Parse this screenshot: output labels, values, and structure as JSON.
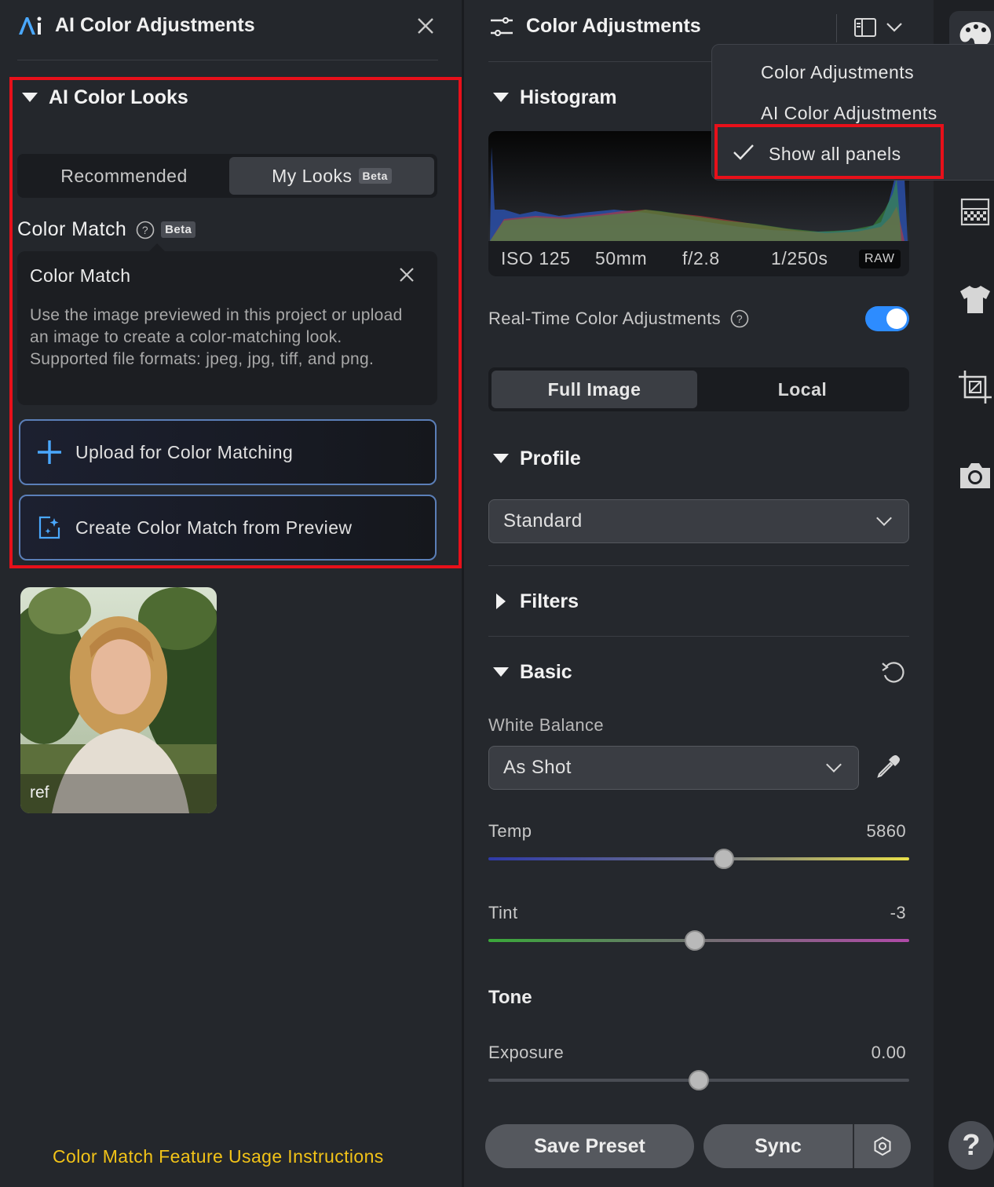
{
  "left_panel": {
    "title": "AI Color Adjustments",
    "section_title": "AI Color Looks",
    "tabs": [
      {
        "label": "Recommended"
      },
      {
        "label": "My Looks",
        "badge": "Beta"
      }
    ],
    "color_match": {
      "label": "Color Match",
      "badge": "Beta",
      "tooltip_title": "Color Match",
      "tooltip_body": "Use the image previewed in this project or upload an image to create a color-matching look. Supported file formats: jpeg, jpg, tiff, and png."
    },
    "upload_button": "Upload for Color Matching",
    "create_button": "Create Color Match from Preview",
    "thumbnail_label": "ref",
    "usage_link": "Color Match Feature Usage Instructions"
  },
  "right_panel": {
    "title": "Color Adjustments",
    "histogram": {
      "title": "Histogram",
      "iso": "ISO 125",
      "focal": "50mm",
      "aperture": "f/2.8",
      "shutter": "1/250s",
      "format": "RAW"
    },
    "realtime": {
      "label": "Real-Time Color Adjustments",
      "enabled": true
    },
    "scope_tabs": [
      {
        "label": "Full Image"
      },
      {
        "label": "Local"
      }
    ],
    "profile": {
      "title": "Profile",
      "value": "Standard"
    },
    "filters": {
      "title": "Filters"
    },
    "basic": {
      "title": "Basic",
      "white_balance_label": "White Balance",
      "white_balance_value": "As Shot",
      "temp": {
        "label": "Temp",
        "value": "5860",
        "position": 0.56
      },
      "tint": {
        "label": "Tint",
        "value": "-3",
        "position": 0.49
      },
      "tone_title": "Tone",
      "exposure": {
        "label": "Exposure",
        "value": "0.00",
        "position": 0.5
      }
    },
    "buttons": {
      "save_preset": "Save Preset",
      "sync": "Sync"
    }
  },
  "menu": {
    "items": [
      "Color Adjustments",
      "AI Color Adjustments",
      "Show all panels"
    ],
    "checked": "Show all panels"
  },
  "colors": {
    "accent_blue": "#2d8cff",
    "highlight_red": "#e8101a",
    "link_yellow": "#f2c318"
  }
}
